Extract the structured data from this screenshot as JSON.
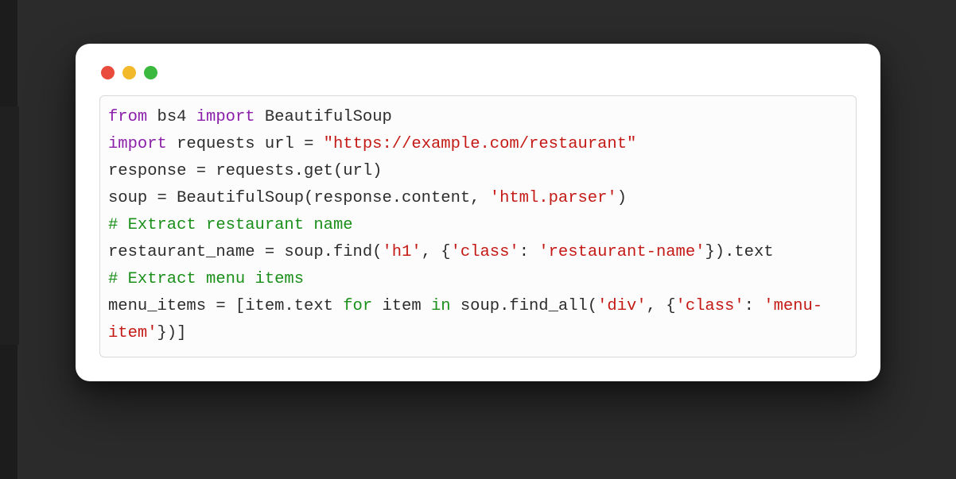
{
  "window": {
    "colors": {
      "close": "#e94b3c",
      "minimize": "#f2b92b",
      "zoom": "#3bb93f"
    }
  },
  "code": {
    "tokens": {
      "kw_from": "from",
      "kw_import": "import",
      "kw_for": "for",
      "kw_in": "in"
    },
    "line1": {
      "mod": "bs4",
      "cls": "BeautifulSoup"
    },
    "line2": {
      "mod": "requests",
      "pre_assign": "url = ",
      "url": "\"https://example.com/restaurant\""
    },
    "line3": "response = requests.get(url)",
    "line4": {
      "pre": "soup = BeautifulSoup(response.content, ",
      "str": "'html.parser'",
      "post": ")"
    },
    "comment1": "# Extract restaurant name",
    "line6": {
      "pre": "restaurant_name = soup.find(",
      "s1": "'h1'",
      "mid1": ", {",
      "s2": "'class'",
      "mid2": ": ",
      "s3": "'restaurant-name'",
      "post": "}).text"
    },
    "comment2": "# Extract menu items",
    "line8": {
      "pre": "menu_items = [item.text ",
      "mid1": " item ",
      "mid2": " soup.find_all(",
      "s1": "'div'",
      "mid3": ", {",
      "s2": "'class'",
      "mid4": ": ",
      "s3": "'menu-item'",
      "post": "})]"
    }
  }
}
